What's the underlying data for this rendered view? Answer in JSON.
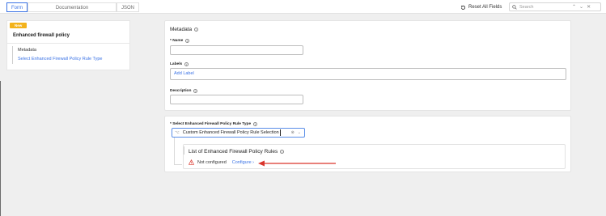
{
  "tabs": [
    "Form",
    "Documentation",
    "JSON"
  ],
  "reset_label": "Reset All Fields",
  "search": {
    "placeholder": "Search",
    "up": "⌃",
    "down": "⌄",
    "close": "✕"
  },
  "sidebar": {
    "badge": "New",
    "title": "Enhanced firewall policy",
    "items": [
      "Metadata",
      "Select Enhanced Firewall Policy Rule Type"
    ]
  },
  "metadata": {
    "title": "Metadata",
    "name_label": "* Name",
    "labels_label": "Labels",
    "add_label": "Add Label",
    "description_label": "Description"
  },
  "rule_type": {
    "label": "* Select Enhanced Firewall Policy Rule Type",
    "selected": "Custom Enhanced Firewall Policy Rule Selection",
    "list_title": "List of Enhanced Firewall Policy Rules",
    "status": "Not configured",
    "configure": "Configure"
  },
  "colors": {
    "accent": "#3a72e5",
    "badge": "#f3b21a",
    "warning": "#d9342b",
    "arrow": "#d9342b"
  }
}
